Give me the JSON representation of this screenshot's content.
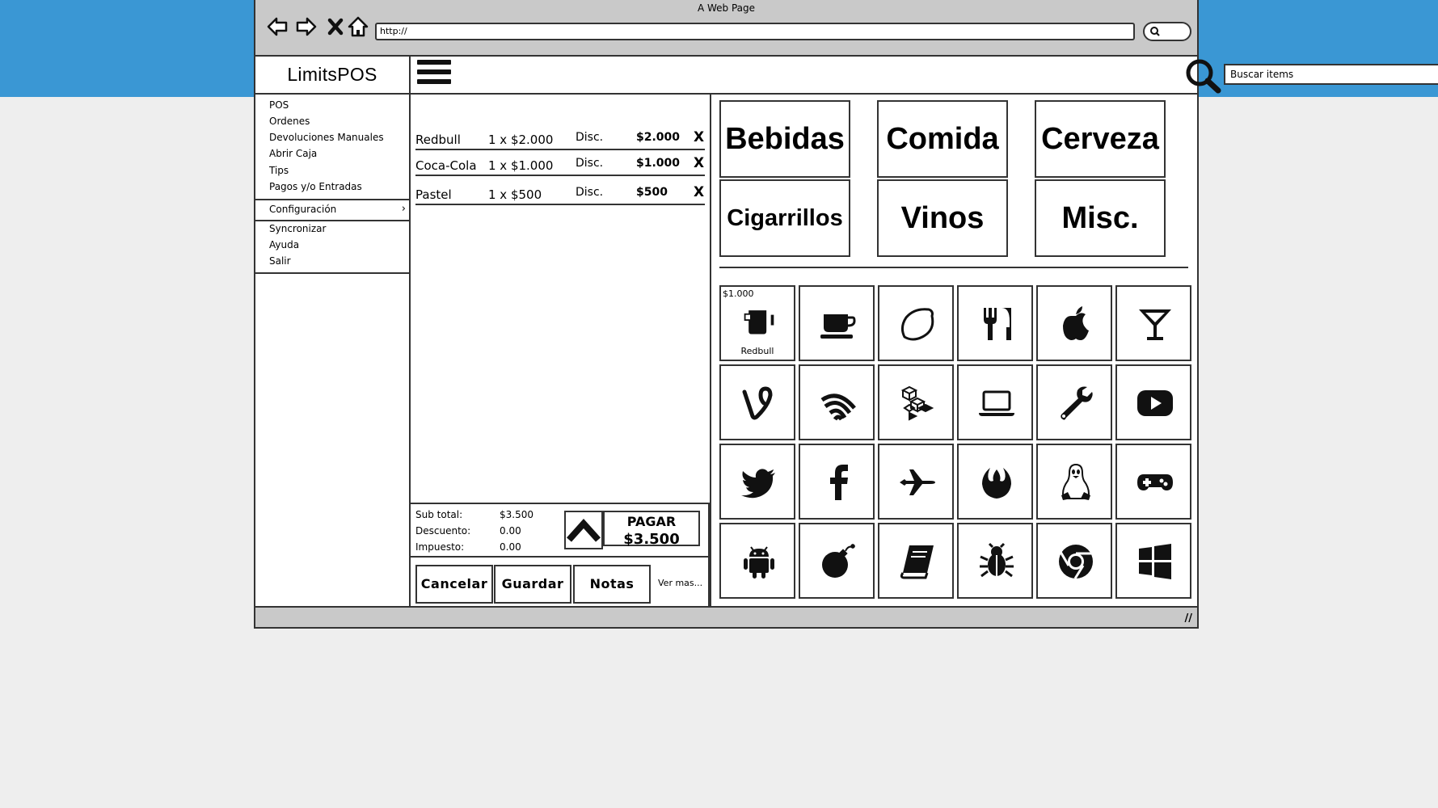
{
  "window": {
    "title": "A Web Page",
    "url": "http://"
  },
  "app": {
    "brand": "LimitsPOS"
  },
  "search": {
    "placeholder": "Buscar items"
  },
  "sidebar": {
    "items": [
      "POS",
      "Ordenes",
      "Devoluciones Manuales",
      "Abrir Caja",
      "Tips",
      "Pagos y/o Entradas"
    ],
    "config_label": "Configuración",
    "bottom_items": [
      "Syncronizar",
      "Ayuda",
      "Salir"
    ]
  },
  "order": {
    "items": [
      {
        "name": "Redbull",
        "qty": "1 x $2.000",
        "disc": "Disc.",
        "amount": "$2.000",
        "remove": "X"
      },
      {
        "name": "Coca-Cola",
        "qty": "1 x $1.000",
        "disc": "Disc.",
        "amount": "$1.000",
        "remove": "X"
      },
      {
        "name": "Pastel",
        "qty": "1 x $500",
        "disc": "Disc.",
        "amount": "$500",
        "remove": "X"
      }
    ],
    "totals": {
      "subtotal_label": "Sub total:",
      "subtotal": "$3.500",
      "discount_label": "Descuento:",
      "discount": "0.00",
      "tax_label": "Impuesto:",
      "tax": "0.00"
    },
    "pay_label": "PAGAR",
    "pay_amount": "$3.500",
    "actions": {
      "cancel": "Cancelar",
      "save": "Guardar",
      "notes": "Notas",
      "more": "Ver mas..."
    }
  },
  "categories": [
    "Bebidas",
    "Comida",
    "Cerveza",
    "Cigarrillos",
    "Vinos",
    "Misc."
  ],
  "products": {
    "first": {
      "price": "$1.000",
      "name": "Redbull"
    },
    "icons": [
      "mug-icon",
      "coffee-cup-icon",
      "lemon-icon",
      "cutlery-icon",
      "apple-icon",
      "cocktail-icon",
      "vine-icon",
      "wireless-icon",
      "dropbox-icon",
      "laptop-icon",
      "wrench-icon",
      "youtube-icon",
      "twitter-icon",
      "facebook-icon",
      "plane-icon",
      "rebel-icon",
      "linux-icon",
      "gamepad-icon",
      "android-icon",
      "bomb-icon",
      "book-icon",
      "bug-icon",
      "chrome-icon",
      "windows-icon"
    ]
  }
}
